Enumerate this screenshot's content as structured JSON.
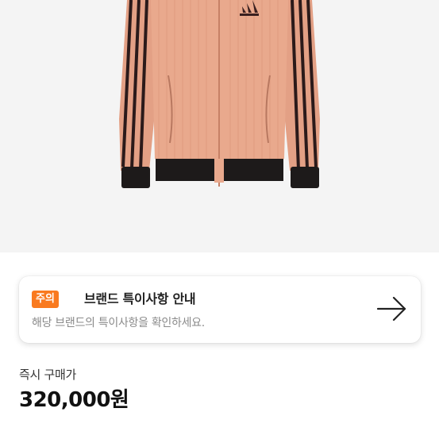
{
  "product": {
    "image_alt": "adidas track jacket"
  },
  "notice": {
    "badge": "주의",
    "title": "브랜드 특이사항 안내",
    "subtitle": "해당 브랜드의 특이사항을 확인하세요.",
    "arrow_icon": "arrow-right-icon"
  },
  "purchase": {
    "label": "즉시 구매가",
    "price": "320,000원"
  },
  "colors": {
    "badge": "#f97a1f",
    "jacket": "#e7a184",
    "stripe": "#2b1a1a"
  }
}
